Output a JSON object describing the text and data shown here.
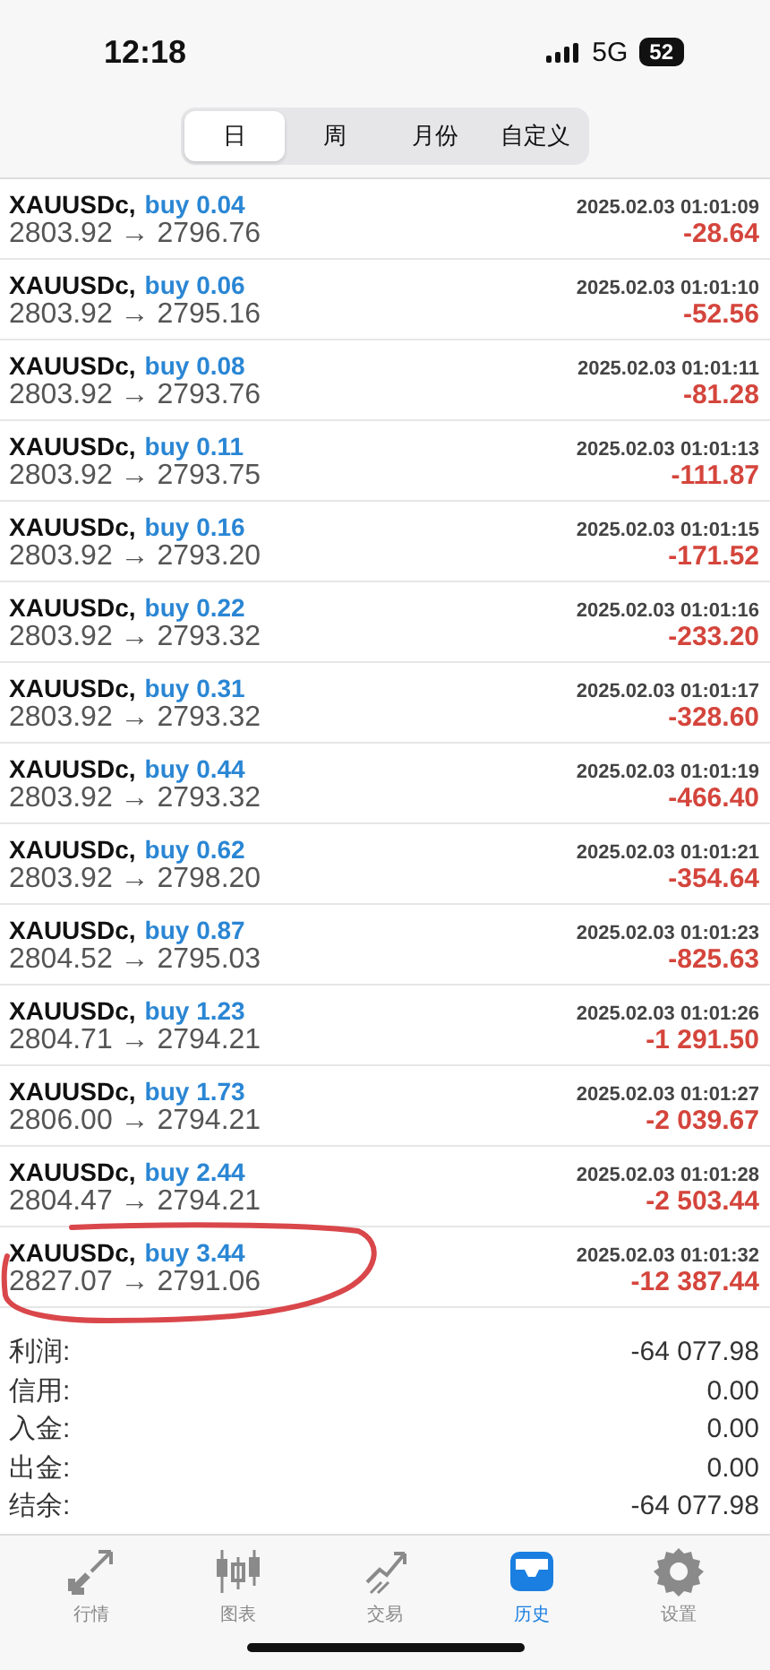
{
  "status_bar": {
    "time": "12:18",
    "network": "5G",
    "battery": "52"
  },
  "tabs": [
    {
      "label": "日",
      "selected": true
    },
    {
      "label": "周",
      "selected": false
    },
    {
      "label": "月份",
      "selected": false
    },
    {
      "label": "自定义",
      "selected": false
    }
  ],
  "deals": [
    {
      "symbol": "XAUUSDc,",
      "order": "buy 0.04",
      "time": "2025.02.03 01:01:09",
      "prices": "2803.92 → 2796.76",
      "profit": "-28.64"
    },
    {
      "symbol": "XAUUSDc,",
      "order": "buy 0.06",
      "time": "2025.02.03 01:01:10",
      "prices": "2803.92 → 2795.16",
      "profit": "-52.56"
    },
    {
      "symbol": "XAUUSDc,",
      "order": "buy 0.08",
      "time": "2025.02.03 01:01:11",
      "prices": "2803.92 → 2793.76",
      "profit": "-81.28"
    },
    {
      "symbol": "XAUUSDc,",
      "order": "buy 0.11",
      "time": "2025.02.03 01:01:13",
      "prices": "2803.92 → 2793.75",
      "profit": "-111.87"
    },
    {
      "symbol": "XAUUSDc,",
      "order": "buy 0.16",
      "time": "2025.02.03 01:01:15",
      "prices": "2803.92 → 2793.20",
      "profit": "-171.52"
    },
    {
      "symbol": "XAUUSDc,",
      "order": "buy 0.22",
      "time": "2025.02.03 01:01:16",
      "prices": "2803.92 → 2793.32",
      "profit": "-233.20"
    },
    {
      "symbol": "XAUUSDc,",
      "order": "buy 0.31",
      "time": "2025.02.03 01:01:17",
      "prices": "2803.92 → 2793.32",
      "profit": "-328.60"
    },
    {
      "symbol": "XAUUSDc,",
      "order": "buy 0.44",
      "time": "2025.02.03 01:01:19",
      "prices": "2803.92 → 2793.32",
      "profit": "-466.40"
    },
    {
      "symbol": "XAUUSDc,",
      "order": "buy 0.62",
      "time": "2025.02.03 01:01:21",
      "prices": "2803.92 → 2798.20",
      "profit": "-354.64"
    },
    {
      "symbol": "XAUUSDc,",
      "order": "buy 0.87",
      "time": "2025.02.03 01:01:23",
      "prices": "2804.52 → 2795.03",
      "profit": "-825.63"
    },
    {
      "symbol": "XAUUSDc,",
      "order": "buy 1.23",
      "time": "2025.02.03 01:01:26",
      "prices": "2804.71 → 2794.21",
      "profit": "-1 291.50"
    },
    {
      "symbol": "XAUUSDc,",
      "order": "buy 1.73",
      "time": "2025.02.03 01:01:27",
      "prices": "2806.00 → 2794.21",
      "profit": "-2 039.67"
    },
    {
      "symbol": "XAUUSDc,",
      "order": "buy 2.44",
      "time": "2025.02.03 01:01:28",
      "prices": "2804.47 → 2794.21",
      "profit": "-2 503.44"
    },
    {
      "symbol": "XAUUSDc,",
      "order": "buy 3.44",
      "time": "2025.02.03 01:01:32",
      "prices": "2827.07 → 2791.06",
      "profit": "-12 387.44"
    }
  ],
  "summary": [
    {
      "label": "利润:",
      "value": "-64 077.98"
    },
    {
      "label": "信用:",
      "value": "0.00"
    },
    {
      "label": "入金:",
      "value": "0.00"
    },
    {
      "label": "出金:",
      "value": "0.00"
    },
    {
      "label": "结余:",
      "value": "-64 077.98"
    }
  ],
  "nav": [
    {
      "kind": "quotes",
      "label": "行情",
      "selected": false
    },
    {
      "kind": "chart",
      "label": "图表",
      "selected": false
    },
    {
      "kind": "trade",
      "label": "交易",
      "selected": false
    },
    {
      "kind": "history",
      "label": "历史",
      "selected": true
    },
    {
      "kind": "settings",
      "label": "设置",
      "selected": false
    }
  ]
}
